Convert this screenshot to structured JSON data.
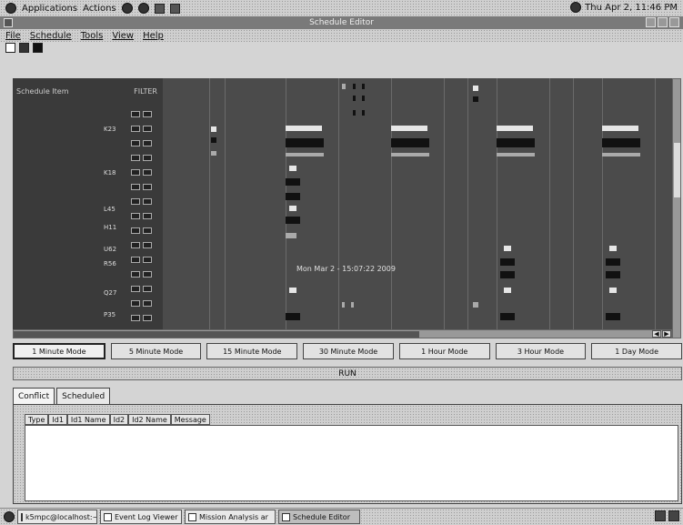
{
  "top_panel": {
    "applications": "Applications",
    "actions": "Actions",
    "clock": "Thu Apr 2, 11:46 PM"
  },
  "window": {
    "title": "Schedule Editor"
  },
  "menu": [
    "File",
    "Schedule",
    "Tools",
    "View",
    "Help"
  ],
  "grid": {
    "col_header": "Schedule Item",
    "filter_label": "FILTER",
    "row_labels": [
      "K23",
      "K18",
      "L45",
      "H11",
      "U62",
      "R56",
      "Q27",
      "P35"
    ],
    "timestamp": "Mon Mar 2 - 15:07:22 2009"
  },
  "modes": [
    "1 Minute Mode",
    "5 Minute Mode",
    "15 Minute Mode",
    "30 Minute Mode",
    "1 Hour Mode",
    "3 Hour Mode",
    "1 Day Mode"
  ],
  "run_label": "RUN",
  "tabs": [
    "Conflict",
    "Scheduled"
  ],
  "table": {
    "columns": [
      "Type",
      "Id1",
      "Id1 Name",
      "Id2",
      "Id2 Name",
      "Message"
    ]
  },
  "taskbar": [
    "k5mpc@localhost:~",
    "Event Log Viewer",
    "Mission Analysis ar",
    "Schedule Editor"
  ]
}
